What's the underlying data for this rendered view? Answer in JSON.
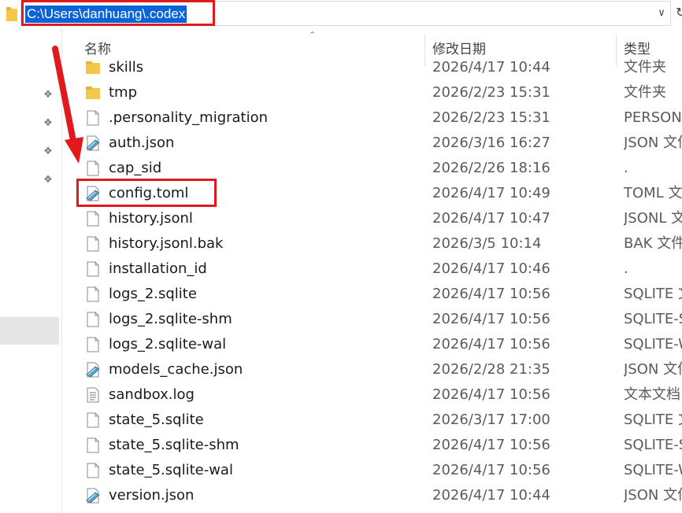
{
  "address": {
    "path": "C:\\Users\\danhuang\\.codex"
  },
  "columns": {
    "name": "名称",
    "date": "修改日期",
    "type": "类型"
  },
  "colors": {
    "highlight": "#e0191f",
    "selection": "#0a64d7"
  },
  "rows": [
    {
      "name": "skills",
      "date": "2026/4/17 10:44",
      "type": "文件夹",
      "icon": "folder-icon"
    },
    {
      "name": "tmp",
      "date": "2026/2/23 15:31",
      "type": "文件夹",
      "icon": "folder-icon"
    },
    {
      "name": ".personality_migration",
      "date": "2026/2/23 15:31",
      "type": "PERSONA",
      "icon": "blank-file-icon"
    },
    {
      "name": "auth.json",
      "date": "2026/3/16 16:27",
      "type": "JSON 文件",
      "icon": "json-file-icon"
    },
    {
      "name": "cap_sid",
      "date": "2026/2/26 18:16",
      "type": ".",
      "icon": "blank-file-icon"
    },
    {
      "name": "config.toml",
      "date": "2026/4/17 10:49",
      "type": "TOML 文件",
      "icon": "json-file-icon"
    },
    {
      "name": "history.jsonl",
      "date": "2026/4/17 10:47",
      "type": "JSONL 文件",
      "icon": "blank-file-icon"
    },
    {
      "name": "history.jsonl.bak",
      "date": "2026/3/5 10:14",
      "type": "BAK 文件",
      "icon": "blank-file-icon"
    },
    {
      "name": "installation_id",
      "date": "2026/4/17 10:46",
      "type": ".",
      "icon": "blank-file-icon"
    },
    {
      "name": "logs_2.sqlite",
      "date": "2026/4/17 10:56",
      "type": "SQLITE 文件",
      "icon": "blank-file-icon"
    },
    {
      "name": "logs_2.sqlite-shm",
      "date": "2026/4/17 10:56",
      "type": "SQLITE-SHM",
      "icon": "blank-file-icon"
    },
    {
      "name": "logs_2.sqlite-wal",
      "date": "2026/4/17 10:56",
      "type": "SQLITE-WAL",
      "icon": "blank-file-icon"
    },
    {
      "name": "models_cache.json",
      "date": "2026/2/28 21:35",
      "type": "JSON 文件",
      "icon": "json-file-icon"
    },
    {
      "name": "sandbox.log",
      "date": "2026/4/17 10:56",
      "type": "文本文档",
      "icon": "text-file-icon"
    },
    {
      "name": "state_5.sqlite",
      "date": "2026/3/17 17:00",
      "type": "SQLITE 文件",
      "icon": "blank-file-icon"
    },
    {
      "name": "state_5.sqlite-shm",
      "date": "2026/4/17 10:56",
      "type": "SQLITE-SHM",
      "icon": "blank-file-icon"
    },
    {
      "name": "state_5.sqlite-wal",
      "date": "2026/4/17 10:56",
      "type": "SQLITE-WAL",
      "icon": "blank-file-icon"
    },
    {
      "name": "version.json",
      "date": "2026/4/17 10:44",
      "type": "JSON 文件",
      "icon": "json-file-icon"
    }
  ]
}
